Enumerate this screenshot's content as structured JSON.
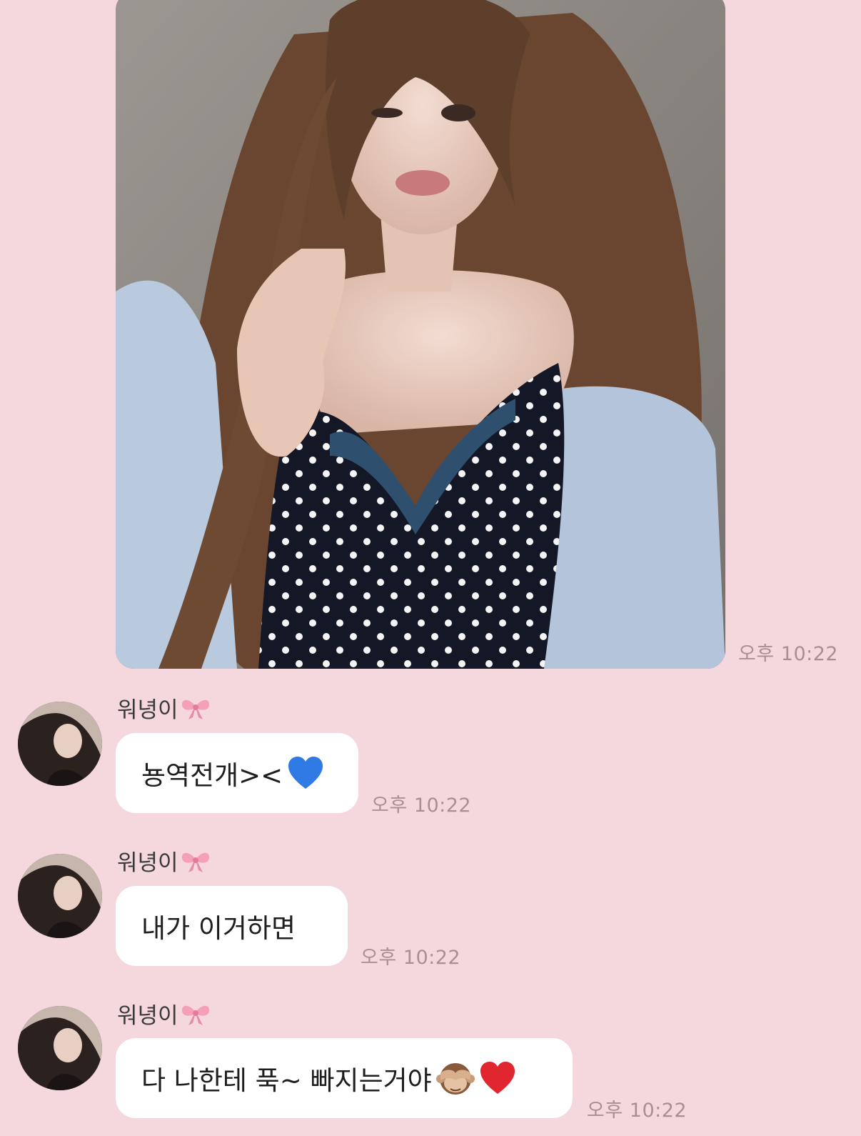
{
  "chat": {
    "photo_message": {
      "time": "오후 10:22"
    },
    "messages": [
      {
        "sender": "워녕이",
        "sender_emoji": "ribbon-icon",
        "text": "뇽역전개><",
        "trailing_emoji": "blue-heart-icon",
        "time": "오후 10:22"
      },
      {
        "sender": "워녕이",
        "sender_emoji": "ribbon-icon",
        "text": "내가 이거하면",
        "time": "오후 10:22"
      },
      {
        "sender": "워녕이",
        "sender_emoji": "ribbon-icon",
        "text": "다 나한테 푹~ 빠지는거야",
        "trailing_emoji": [
          "see-no-evil-monkey-icon",
          "red-heart-icon"
        ],
        "time": "오후 10:22"
      }
    ]
  },
  "colors": {
    "background": "#f4d8de",
    "bubble": "#ffffff",
    "timestamp": "#a98f95",
    "ribbon": "#f3a0b8",
    "blue_heart": "#2f7ae5",
    "red_heart": "#e0262e"
  }
}
